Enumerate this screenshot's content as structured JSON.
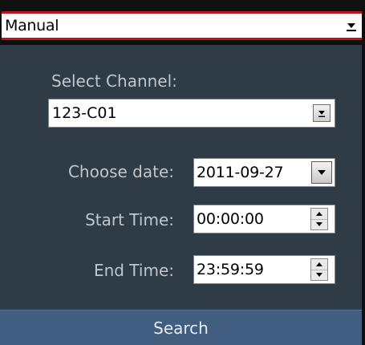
{
  "mode": {
    "selected": "Manual"
  },
  "channel": {
    "label": "Select Channel:",
    "selected": "123-C01"
  },
  "date": {
    "label": "Choose date:",
    "value": "2011-09-27"
  },
  "start_time": {
    "label": "Start Time:",
    "value": "00:00:00"
  },
  "end_time": {
    "label": "End Time:",
    "value": "23:59:59"
  },
  "search": {
    "label": "Search"
  },
  "colors": {
    "panel": "#2f3c46",
    "accent_border": "#c0121a",
    "search_button": "#415d7f"
  }
}
